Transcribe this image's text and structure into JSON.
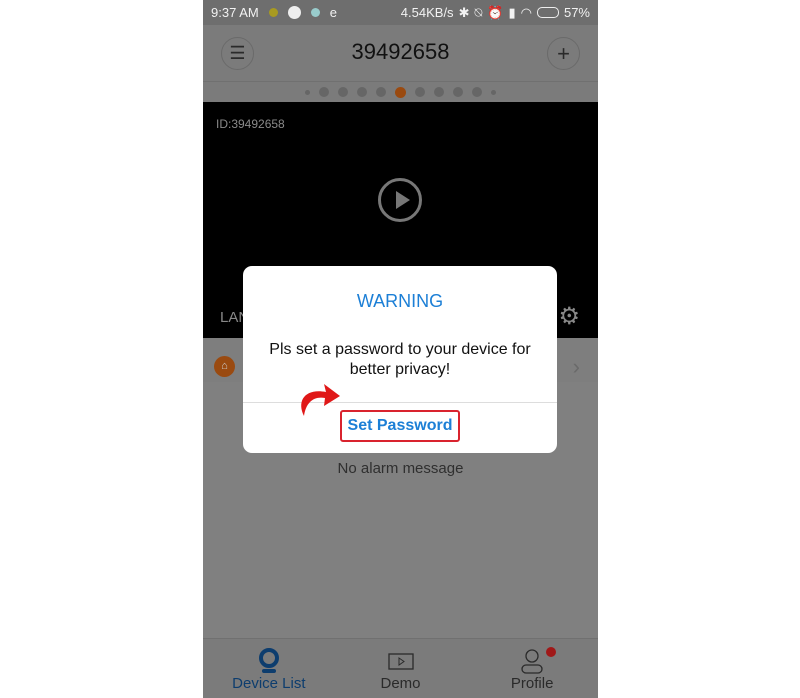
{
  "status_bar": {
    "time": "9:37 AM",
    "network_speed": "4.54KB/s",
    "battery": "57%",
    "e_label": "e"
  },
  "header": {
    "title": "39492658"
  },
  "pager": {
    "count": 11,
    "active_index": 5
  },
  "video": {
    "device_id": "ID:39492658",
    "connection_label": "LAN"
  },
  "alarm": {
    "empty_text": "No alarm message"
  },
  "tabs": [
    {
      "label": "Device List",
      "active": true
    },
    {
      "label": "Demo"
    },
    {
      "label": "Profile",
      "badge": true
    }
  ],
  "dialog": {
    "title": "WARNING",
    "message": "Pls set a password to your device for better privacy!",
    "button": "Set Password"
  },
  "colors": {
    "accent": "#1c7fd6",
    "highlight": "#d9232e",
    "active_tab": "#0d3d6e"
  }
}
